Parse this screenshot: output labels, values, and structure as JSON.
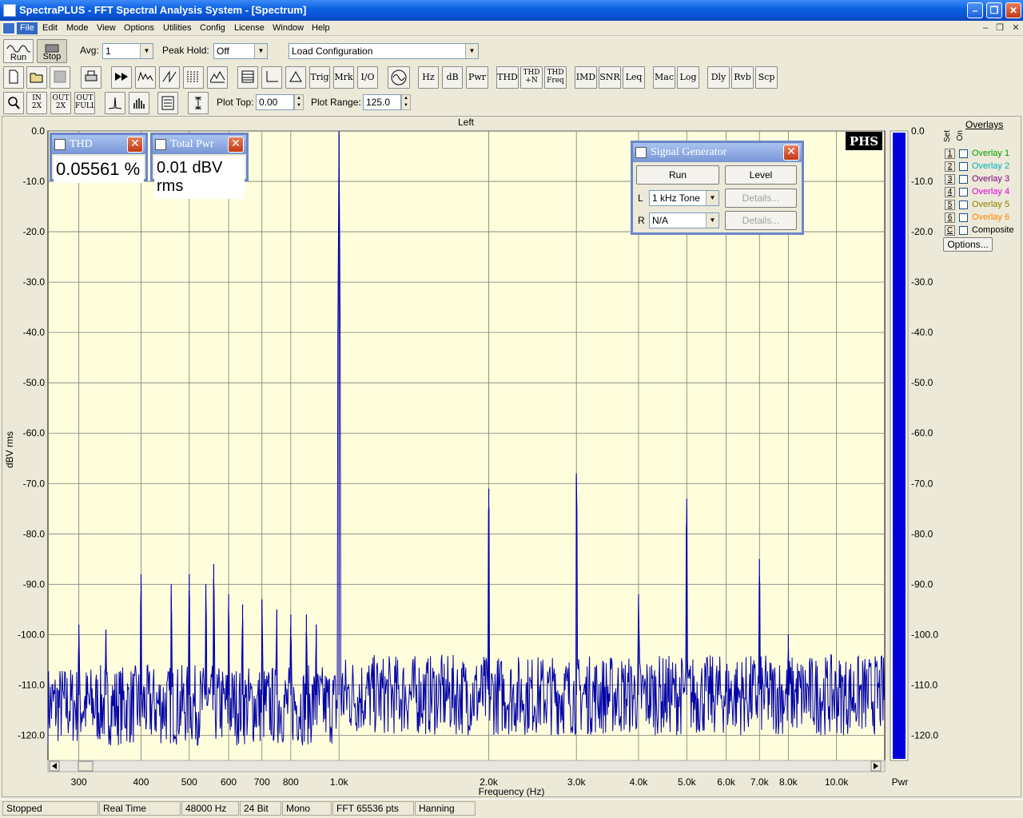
{
  "window": {
    "title": "SpectraPLUS - FFT Spectral Analysis System - [Spectrum]"
  },
  "menu": [
    "File",
    "Edit",
    "Mode",
    "View",
    "Options",
    "Utilities",
    "Config",
    "License",
    "Window",
    "Help"
  ],
  "toolbar1": {
    "run_label": "Run",
    "stop_label": "Stop",
    "avg_label": "Avg:",
    "avg_value": "1",
    "peak_hold_label": "Peak Hold:",
    "peak_hold_value": "Off",
    "config_value": "Load Configuration"
  },
  "toolbar2": {
    "text_buttons": [
      "Trig",
      "Mrk",
      "I/O",
      "Hz",
      "dB",
      "Pwr",
      "THD",
      "THD +N",
      "THD Freq",
      "IMD",
      "SNR",
      "Leq",
      "Mac",
      "Log",
      "Dly",
      "Rvb",
      "Scp"
    ]
  },
  "toolbar3": {
    "zoom_in_label": "IN 2X",
    "zoom_out_label": "OUT 2X",
    "zoom_full_label": "OUT FULL",
    "plot_top_label": "Plot Top:",
    "plot_top_value": "0.00",
    "plot_range_label": "Plot Range:",
    "plot_range_value": "125.0"
  },
  "plot": {
    "channel_title": "Left",
    "logo": "PHS",
    "bar_label": "Pwr",
    "level_fraction": 1.0
  },
  "overlays": {
    "title": "Overlays",
    "set_header": "Set",
    "on_header": "On",
    "items": [
      {
        "num": "1",
        "label": "Overlay 1",
        "color": "#00a000"
      },
      {
        "num": "2",
        "label": "Overlay 2",
        "color": "#00b0c0"
      },
      {
        "num": "3",
        "label": "Overlay 3",
        "color": "#800080"
      },
      {
        "num": "4",
        "label": "Overlay 4",
        "color": "#e000e0"
      },
      {
        "num": "5",
        "label": "Overlay 5",
        "color": "#908000"
      },
      {
        "num": "6",
        "label": "Overlay 6",
        "color": "#ff8000"
      },
      {
        "num": "C",
        "label": "Composite",
        "color": "#000000"
      }
    ],
    "options_label": "Options..."
  },
  "thd_window": {
    "title": "THD",
    "value": "0.05561 %"
  },
  "pwr_window": {
    "title": "Total Pwr",
    "value": "0.01 dBV rms"
  },
  "siggen": {
    "title": "Signal Generator",
    "run_label": "Run",
    "level_label": "Level",
    "l_label": "L",
    "l_value": "1 kHz Tone",
    "r_label": "R",
    "r_value": "N/A",
    "details_label": "Details..."
  },
  "status": [
    "Stopped",
    "Real Time",
    "48000 Hz",
    "24 Bit",
    "Mono",
    "FFT 65536 pts",
    "Hanning"
  ],
  "chart_data": {
    "type": "line",
    "title": "Left",
    "xlabel": "Frequency (Hz)",
    "ylabel": "dBV rms",
    "x_scale": "log",
    "xlim": [
      260,
      12500
    ],
    "ylim": [
      -125,
      0
    ],
    "y_ticks": [
      "0.0",
      "-10.0",
      "-20.0",
      "-30.0",
      "-40.0",
      "-50.0",
      "-60.0",
      "-70.0",
      "-80.0",
      "-90.0",
      "-100.0",
      "-110.0",
      "-120.0"
    ],
    "x_ticks": [
      {
        "v": 300,
        "label": "300"
      },
      {
        "v": 400,
        "label": "400"
      },
      {
        "v": 500,
        "label": "500"
      },
      {
        "v": 600,
        "label": "600"
      },
      {
        "v": 700,
        "label": "700"
      },
      {
        "v": 800,
        "label": "800"
      },
      {
        "v": 1000,
        "label": "1.0k"
      },
      {
        "v": 2000,
        "label": "2.0k"
      },
      {
        "v": 3000,
        "label": "3.0k"
      },
      {
        "v": 4000,
        "label": "4.0k"
      },
      {
        "v": 5000,
        "label": "5.0k"
      },
      {
        "v": 6000,
        "label": "6.0k"
      },
      {
        "v": 7000,
        "label": "7.0k"
      },
      {
        "v": 8000,
        "label": "8.0k"
      },
      {
        "v": 10000,
        "label": "10.0k"
      }
    ],
    "grid": true,
    "noise_floor_db": -112,
    "peaks": [
      {
        "x": 300,
        "y": -98
      },
      {
        "x": 340,
        "y": -99
      },
      {
        "x": 400,
        "y": -88
      },
      {
        "x": 460,
        "y": -90
      },
      {
        "x": 500,
        "y": -88
      },
      {
        "x": 540,
        "y": -90
      },
      {
        "x": 560,
        "y": -86
      },
      {
        "x": 600,
        "y": -92
      },
      {
        "x": 640,
        "y": -94
      },
      {
        "x": 700,
        "y": -93
      },
      {
        "x": 750,
        "y": -95
      },
      {
        "x": 800,
        "y": -96
      },
      {
        "x": 860,
        "y": -96
      },
      {
        "x": 900,
        "y": -98
      },
      {
        "x": 1000,
        "y": 0
      },
      {
        "x": 2000,
        "y": -71
      },
      {
        "x": 3000,
        "y": -68
      },
      {
        "x": 4000,
        "y": -92
      },
      {
        "x": 5000,
        "y": -73
      },
      {
        "x": 7000,
        "y": -85
      },
      {
        "x": 8000,
        "y": -100
      }
    ]
  }
}
